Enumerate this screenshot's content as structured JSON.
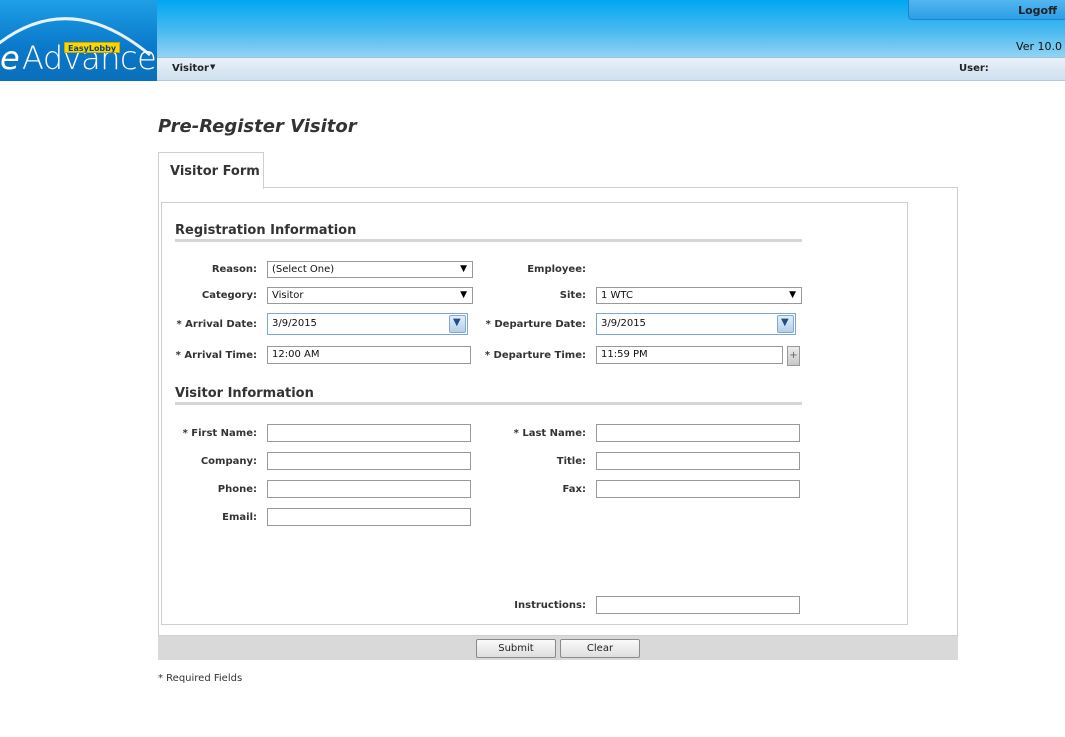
{
  "header": {
    "logo_e": "e",
    "logo_text": "Advance",
    "logo_badge": "EasyLobby",
    "logoff_label": "Logoff",
    "version": "Ver 10.0"
  },
  "menu": {
    "visitor_label": "Visitor",
    "user_label": "User:"
  },
  "page": {
    "title": "Pre-Register Visitor",
    "tab_label": "Visitor Form"
  },
  "registration": {
    "section_title": "Registration Information",
    "reason_label": "Reason:",
    "reason_value": "(Select One)",
    "employee_label": "Employee:",
    "category_label": "Category:",
    "category_value": "Visitor",
    "site_label": "Site:",
    "site_value": "1 WTC",
    "arrival_date_label": "* Arrival Date:",
    "arrival_date_value": "3/9/2015",
    "departure_date_label": "* Departure Date:",
    "departure_date_value": "3/9/2015",
    "arrival_time_label": "* Arrival Time:",
    "arrival_time_value": "12:00 AM",
    "departure_time_label": "* Departure Time:",
    "departure_time_value": "11:59 PM"
  },
  "visitor": {
    "section_title": "Visitor Information",
    "first_name_label": "* First Name:",
    "first_name_value": "",
    "last_name_label": "* Last Name:",
    "last_name_value": "",
    "company_label": "Company:",
    "company_value": "",
    "title_label": "Title:",
    "title_value": "",
    "phone_label": "Phone:",
    "phone_value": "",
    "fax_label": "Fax:",
    "fax_value": "",
    "email_label": "Email:",
    "email_value": "",
    "instructions_label": "Instructions:",
    "instructions_value": ""
  },
  "buttons": {
    "submit": "Submit",
    "clear": "Clear"
  },
  "footer": {
    "required_note": "* Required Fields"
  },
  "icons": {
    "dropdown": "chevron-down-icon",
    "calendar": "calendar-dropdown-icon",
    "add": "plus-icon"
  },
  "colors": {
    "header_blue": "#00a7f2",
    "logo_blue": "#0a78c9",
    "badge_yellow": "#ffd400"
  }
}
